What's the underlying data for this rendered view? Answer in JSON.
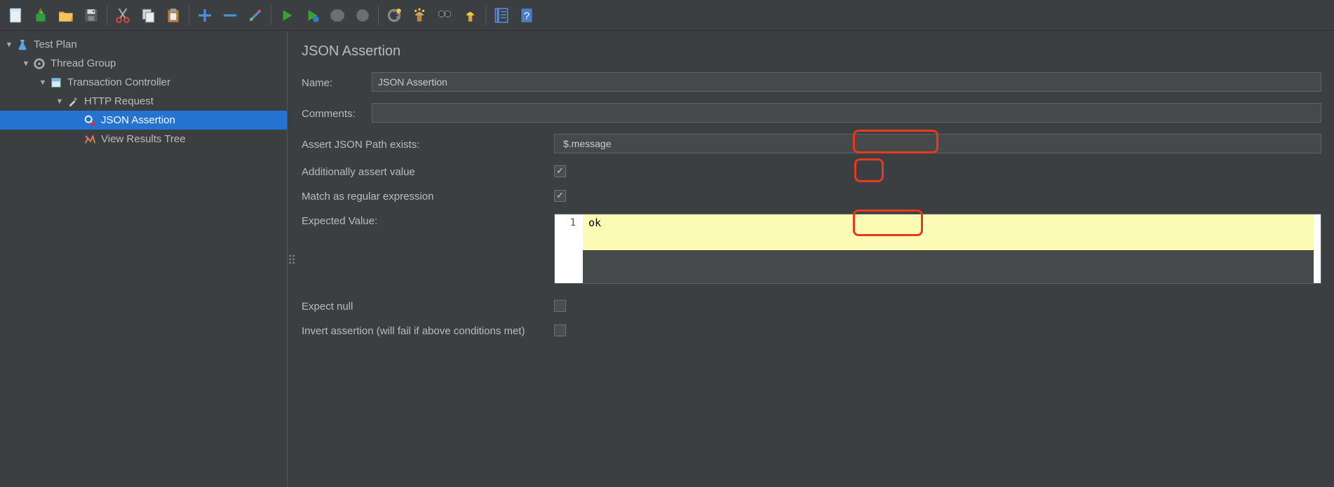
{
  "toolbar": {
    "buttons": [
      "new-file",
      "new-template",
      "open",
      "save",
      "",
      "cut",
      "copy",
      "paste",
      "",
      "zoom-in",
      "zoom-out",
      "color-picker",
      "",
      "run",
      "run-no-timer",
      "stop",
      "shutdown",
      "",
      "gear",
      "broom",
      "binoculars",
      "clean",
      "",
      "function-helper",
      "help"
    ]
  },
  "tree": {
    "test_plan": "Test Plan",
    "thread_group": "Thread Group",
    "transaction_controller": "Transaction Controller",
    "http_request": "HTTP Request",
    "json_assertion": "JSON Assertion",
    "view_results_tree": "View Results Tree"
  },
  "panel": {
    "title": "JSON Assertion",
    "name_label": "Name:",
    "name_value": "JSON Assertion",
    "comments_label": "Comments:",
    "comments_value": "",
    "jsonpath_label": "Assert JSON Path exists:",
    "jsonpath_value": "$.message",
    "assert_value_label": "Additionally assert value",
    "assert_value_checked": true,
    "regex_label": "Match as regular expression",
    "regex_checked": true,
    "expected_label": "Expected Value:",
    "expected_line_no": "1",
    "expected_value": "ok",
    "expect_null_label": "Expect null",
    "expect_null_checked": false,
    "invert_label": "Invert assertion (will fail if above conditions met)",
    "invert_checked": false
  }
}
